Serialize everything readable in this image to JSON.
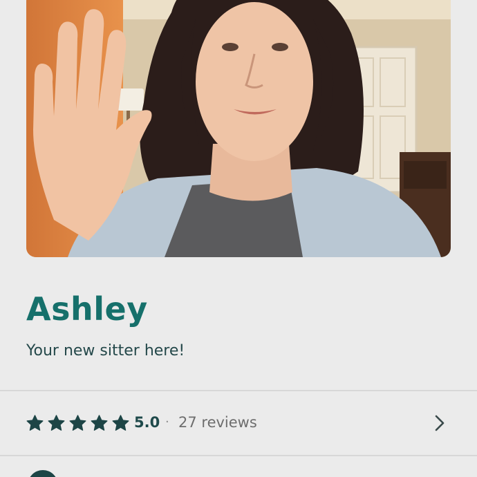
{
  "profile": {
    "name": "Ashley",
    "tagline": "Your new sitter here!",
    "photo_alt": "Profile photo"
  },
  "rating": {
    "stars": 5,
    "max_stars": 5,
    "value": "5.0",
    "separator": "·",
    "reviews": "27 reviews"
  },
  "icons": {
    "star": "star-icon",
    "chevron": "chevron-right-icon",
    "next_row_avatar": "circle-icon"
  },
  "colors": {
    "accent": "#16706b",
    "star": "#1d4546",
    "text_dark": "#24484a",
    "text_muted": "#6d6d6d",
    "background": "#ebebeb",
    "divider": "#d7d7d7"
  }
}
